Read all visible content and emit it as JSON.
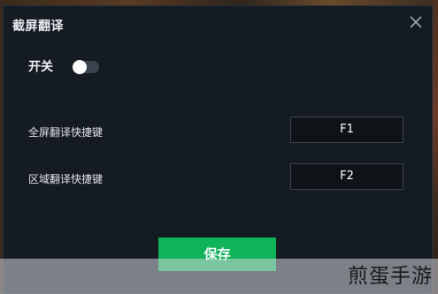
{
  "dialog": {
    "title": "截屏翻译",
    "close_icon": "close-icon"
  },
  "toggle": {
    "label": "开关",
    "state": "off"
  },
  "hotkeys": [
    {
      "label": "全屏翻译快捷键",
      "key": "F1"
    },
    {
      "label": "区域翻译快捷键",
      "key": "F2"
    }
  ],
  "save_label": "保存",
  "watermark": "煎蛋手游",
  "colors": {
    "dialog_bg": "#151b22",
    "save_button": "#0fb35a",
    "toggle_track": "#3a4450"
  }
}
